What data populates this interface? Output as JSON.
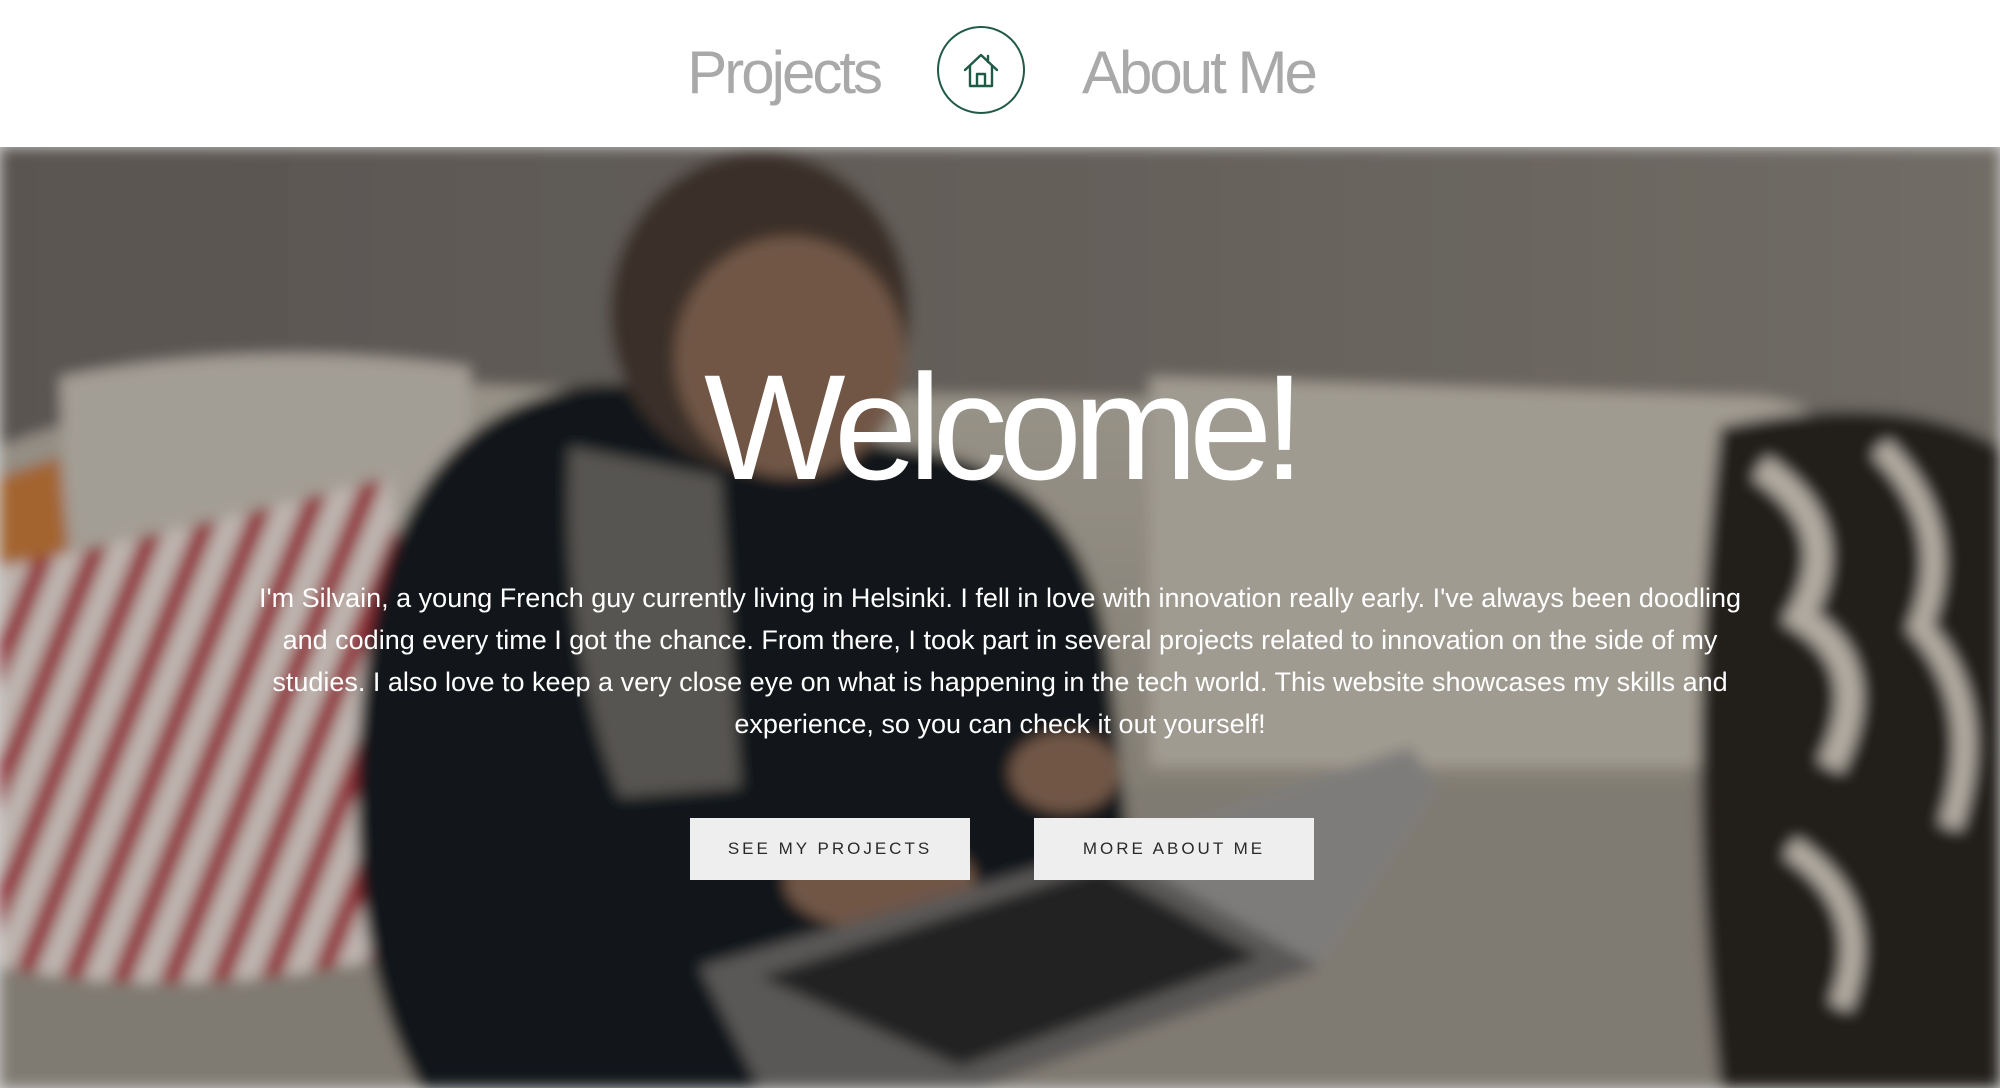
{
  "nav": {
    "projects_label": "Projects",
    "about_label": "About Me",
    "home_icon": "home-icon",
    "accent_color": "#1f5a45"
  },
  "hero": {
    "title": "Welcome!",
    "intro": "I'm Silvain, a young French guy currently living in Helsinki. I fell in love with innovation really early. I've always been doodling and coding every time I got the chance. From there, I took part in several projects related to innovation on the side of my studies. I also love to keep a very close eye on what is happening in the tech world. This website showcases my skills and experience, so you can check it out yourself!",
    "buttons": [
      {
        "label": "SEE MY PROJECTS"
      },
      {
        "label": "MORE ABOUT ME"
      }
    ]
  }
}
